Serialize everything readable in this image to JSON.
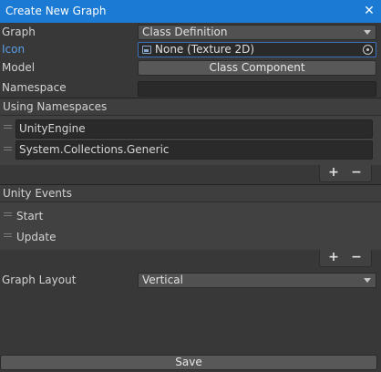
{
  "window": {
    "title": "Create New Graph",
    "close_glyph": "✕"
  },
  "fields": {
    "graph": {
      "label": "Graph",
      "value": "Class Definition"
    },
    "icon": {
      "label": "Icon",
      "value": "None (Texture 2D)"
    },
    "model": {
      "label": "Model",
      "button": "Class Component"
    },
    "namespace": {
      "label": "Namespace",
      "value": ""
    }
  },
  "using_namespaces": {
    "header": "Using Namespaces",
    "items": [
      "UnityEngine",
      "System.Collections.Generic"
    ],
    "add": "+",
    "remove": "−"
  },
  "unity_events": {
    "header": "Unity Events",
    "items": [
      "Start",
      "Update"
    ],
    "add": "+",
    "remove": "−"
  },
  "graph_layout": {
    "label": "Graph Layout",
    "value": "Vertical"
  },
  "save_button": "Save",
  "colors": {
    "titlebar": "#1a7ad4",
    "background": "#383838",
    "icon_label": "#5a9ee6"
  }
}
